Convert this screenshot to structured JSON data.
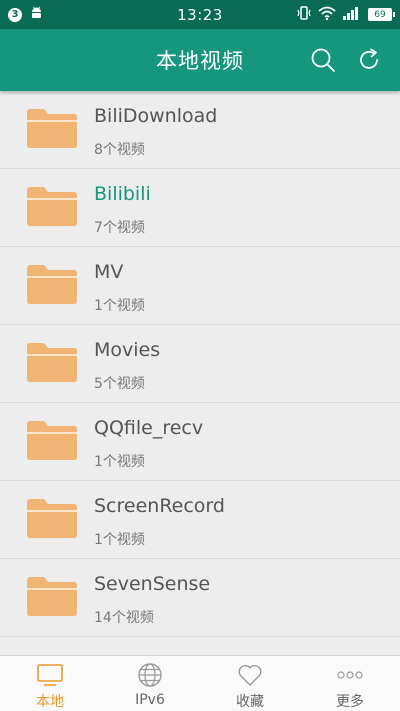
{
  "status_bar": {
    "notification_count": "3",
    "time": "13:23",
    "battery": "69"
  },
  "app_bar": {
    "title": "本地视频"
  },
  "folders": [
    {
      "name": "BiliDownload",
      "count": "8个视频",
      "selected": false
    },
    {
      "name": "Bilibili",
      "count": "7个视频",
      "selected": true
    },
    {
      "name": "MV",
      "count": "1个视频",
      "selected": false
    },
    {
      "name": "Movies",
      "count": "5个视频",
      "selected": false
    },
    {
      "name": "QQfile_recv",
      "count": "1个视频",
      "selected": false
    },
    {
      "name": "ScreenRecord",
      "count": "1个视频",
      "selected": false
    },
    {
      "name": "SevenSense",
      "count": "14个视频",
      "selected": false
    },
    {
      "name": "",
      "count": "",
      "selected": false
    }
  ],
  "bottom_nav": [
    {
      "label": "本地",
      "icon": "tv-icon",
      "active": true
    },
    {
      "label": "IPv6",
      "icon": "globe-icon",
      "active": false
    },
    {
      "label": "收藏",
      "icon": "heart-icon",
      "active": false
    },
    {
      "label": "更多",
      "icon": "more-icon",
      "active": false
    }
  ],
  "colors": {
    "status_bar": "#0a6b55",
    "app_bar": "#14977c",
    "folder": "#f0b575",
    "active_tab": "#e89a2c",
    "selected_text": "#14977c"
  }
}
